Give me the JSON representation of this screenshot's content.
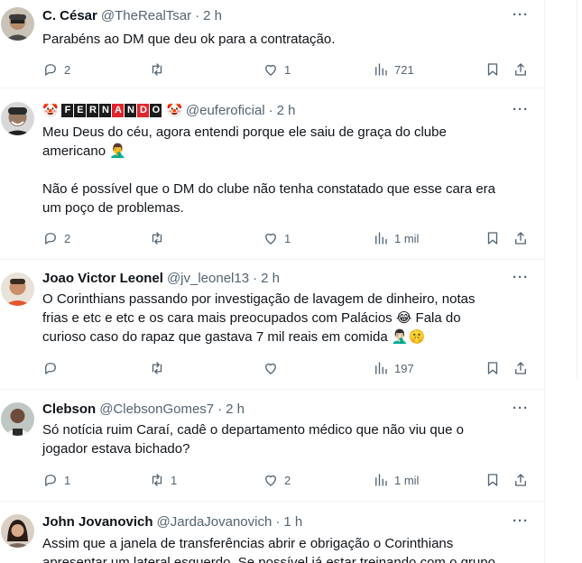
{
  "tweets": [
    {
      "name": "C. César",
      "handle": "@TheRealTsar",
      "time": "2 h",
      "text": [
        "Parabéns ao DM que deu ok para a contratação."
      ],
      "replies": "2",
      "retweets": "",
      "likes": "1",
      "views": "721"
    },
    {
      "name_letters": [
        "F",
        "E",
        "R",
        "N",
        "A",
        "N",
        "D",
        "O"
      ],
      "name_emoji": "🤡",
      "handle": "@euferoficial",
      "time": "2 h",
      "text": [
        "Meu Deus do céu, agora entendi porque ele saiu de graça do clube",
        "americano 🤦‍♂️",
        "",
        "Não é possível que o DM do clube não tenha constatado que esse cara era",
        "um poço de problemas."
      ],
      "replies": "2",
      "retweets": "",
      "likes": "1",
      "views": "1 mil"
    },
    {
      "name": "Joao Victor Leonel",
      "handle": "@jv_leonel13",
      "time": "2 h",
      "text": [
        "O Corinthians passando por investigação de lavagem de dinheiro, notas",
        "frias e etc e etc e os cara mais preocupados com Palácios 😂 Fala do",
        "curioso caso do rapaz que gastava 7 mil reais em comida 🤦🏻‍♂️🤫"
      ],
      "replies": "",
      "retweets": "",
      "likes": "",
      "views": "197"
    },
    {
      "name": "Clebson",
      "handle": "@ClebsonGomes7",
      "time": "2 h",
      "text": [
        "Só notícia ruim Caraí, cadê o departamento médico que não viu que o",
        "jogador estava bichado?"
      ],
      "replies": "1",
      "retweets": "1",
      "likes": "2",
      "views": "1 mil"
    },
    {
      "name": "John Jovanovich",
      "handle": "@JardaJovanovich",
      "time": "1 h",
      "text": [
        "Assim que a janela de transferências abrir e obrigação o Corinthians",
        "apresentar um lateral esquerdo. Se possível já estar treinando com o grupo"
      ],
      "replies": "",
      "retweets": "",
      "likes": "",
      "views": ""
    }
  ],
  "ui": {
    "separator": "·",
    "more": "···"
  },
  "icons": [
    "reply-icon",
    "retweet-icon",
    "like-icon",
    "views-icon",
    "bookmark-icon",
    "share-icon",
    "more-icon"
  ],
  "colors": {
    "secondary_text": "#536471",
    "divider": "#eff3f4",
    "badge_black": "#1b1b1b",
    "badge_red": "#e0262e"
  }
}
